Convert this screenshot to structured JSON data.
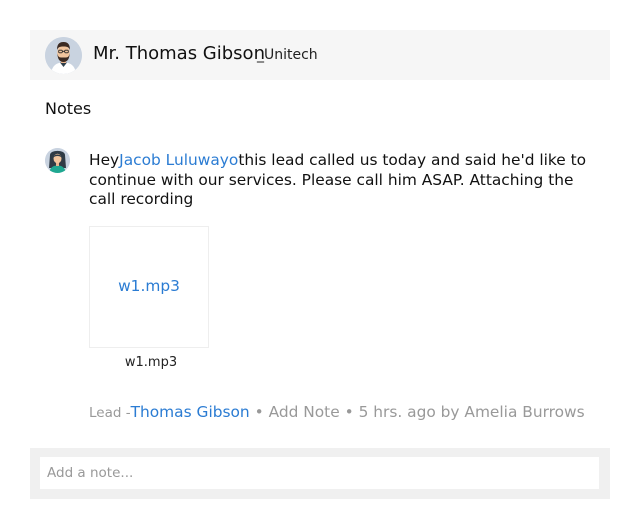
{
  "lead": {
    "name": "Mr. Thomas Gibson",
    "company": "_Unitech"
  },
  "notes_section": {
    "title": "Notes"
  },
  "note": {
    "text_before_mention": "Hey",
    "mention": "Jacob Luluwayo",
    "text_after_mention": "this lead called us today and said he'd like to continue with our services. Please call him ASAP. Attaching the call recording",
    "attachment": {
      "label": "w1.mp3",
      "caption": "w1.mp3"
    },
    "meta": {
      "lead_prefix": "Lead -",
      "lead_link": "Thomas Gibson",
      "separator_1": " • ",
      "add_note_label": "Add Note",
      "separator_2": " • ",
      "time_and_author": "5 hrs. ago by Amelia Burrows"
    }
  },
  "composer": {
    "placeholder": "Add a note..."
  },
  "colors": {
    "link": "#2b7cd3",
    "muted_text": "#999999",
    "header_background": "#f6f6f6",
    "composer_background": "#f0f0f0"
  },
  "icons": {
    "lead_avatar": "bearded-man-avatar-icon",
    "author_avatar": "woman-avatar-icon"
  }
}
